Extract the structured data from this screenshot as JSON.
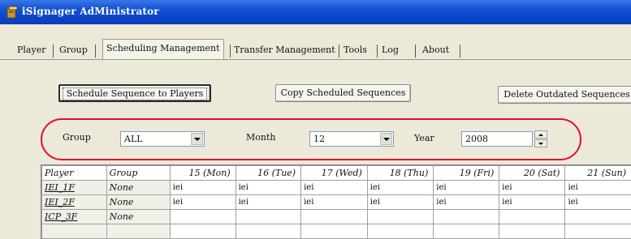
{
  "window": {
    "title": "iSignager AdMinistrator"
  },
  "tabs": [
    {
      "label": "Player"
    },
    {
      "label": "Group"
    },
    {
      "label": "Scheduling Management",
      "active": true
    },
    {
      "label": "Transfer Management"
    },
    {
      "label": "Tools"
    },
    {
      "label": "Log"
    },
    {
      "label": "About"
    }
  ],
  "buttons": {
    "schedule": "Schedule Sequence to Players",
    "copy": "Copy Scheduled Sequences",
    "delete": "Delete Outdated Sequences"
  },
  "filters": {
    "group_label": "Group",
    "group_value": "ALL",
    "month_label": "Month",
    "month_value": "12",
    "year_label": "Year",
    "year_value": "2008"
  },
  "grid": {
    "headers": [
      "Player",
      "Group",
      "15 (Mon)",
      "16 (Tue)",
      "17 (Wed)",
      "18 (Thu)",
      "19 (Fri)",
      "20 (Sat)",
      "21 (Sun)"
    ],
    "rows": [
      {
        "player": "IEI_1F",
        "group": "None",
        "cells": [
          "iei",
          "iei",
          "iei",
          "iei",
          "iei",
          "iei",
          "iei"
        ]
      },
      {
        "player": "IEI_2F",
        "group": "None",
        "cells": [
          "iei",
          "iei",
          "iei",
          "iei",
          "iei",
          "iei",
          "iei"
        ]
      },
      {
        "player": "ICP_3F",
        "group": "None",
        "cells": [
          "",
          "",
          "",
          "",
          "",
          "",
          ""
        ]
      },
      {
        "player": "",
        "group": "",
        "cells": [
          "",
          "",
          "",
          "",
          "",
          "",
          ""
        ]
      }
    ]
  },
  "colors": {
    "titlebar": "#0a45c8",
    "highlight": "#e0102a",
    "background": "#ece9d8"
  }
}
